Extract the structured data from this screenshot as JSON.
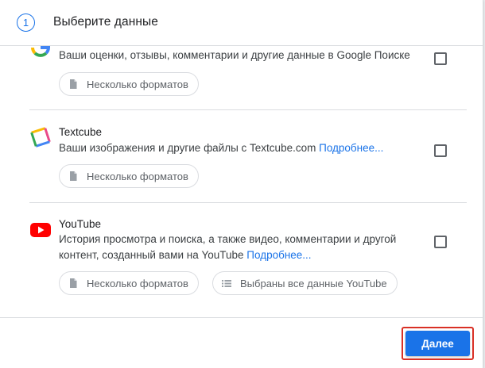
{
  "header": {
    "step_number": "1",
    "title": "Выберите данные"
  },
  "items": [
    {
      "icon": "google-icon",
      "description": "Ваши оценки, отзывы, комментарии и другие данные в Google Поиске",
      "chips": [
        "Несколько форматов"
      ]
    },
    {
      "icon": "textcube-icon",
      "title": "Textcube",
      "description": "Ваши изображения и другие файлы с Textcube.com",
      "link": "Подробнее...",
      "chips": [
        "Несколько форматов"
      ]
    },
    {
      "icon": "youtube-icon",
      "title": "YouTube",
      "description": "История просмотра и поиска, а также видео, комментарии и другой контент, созданный вами на YouTube",
      "link": "Подробнее...",
      "chips": [
        "Несколько форматов",
        "Выбраны все данные YouTube"
      ]
    }
  ],
  "footer": {
    "next_label": "Далее"
  },
  "colors": {
    "accent": "#1a73e8",
    "highlight": "#d93025",
    "youtube": "#ff0000"
  }
}
